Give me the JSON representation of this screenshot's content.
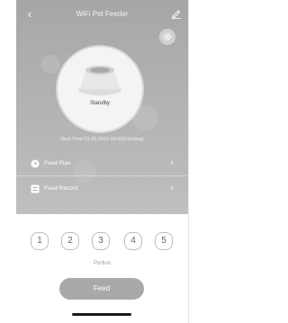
{
  "nav": {
    "title": "WiFi Pet Feeder",
    "back_icon": "chevron-left-icon",
    "edit_icon": "pencil-icon"
  },
  "device": {
    "settings_icon": "gear-icon",
    "image_icon": "pet-bowl-icon",
    "status": "Standby",
    "next_time": "Next Time:22.09.2022 09:03(Feeding)"
  },
  "menu": [
    {
      "label": "Feed Plan",
      "icon": "clock-icon"
    },
    {
      "label": "Feed Record",
      "icon": "list-icon"
    }
  ],
  "portions": [
    "1",
    "2",
    "3",
    "4",
    "5"
  ],
  "portion_label": "Portion",
  "feed_button": "Feed",
  "colors": {
    "header_top": "#a6a6a6",
    "header_bottom": "#bfbfbf",
    "feed_button": "#a9a9a9",
    "portion_border": "#bdbdbd"
  }
}
